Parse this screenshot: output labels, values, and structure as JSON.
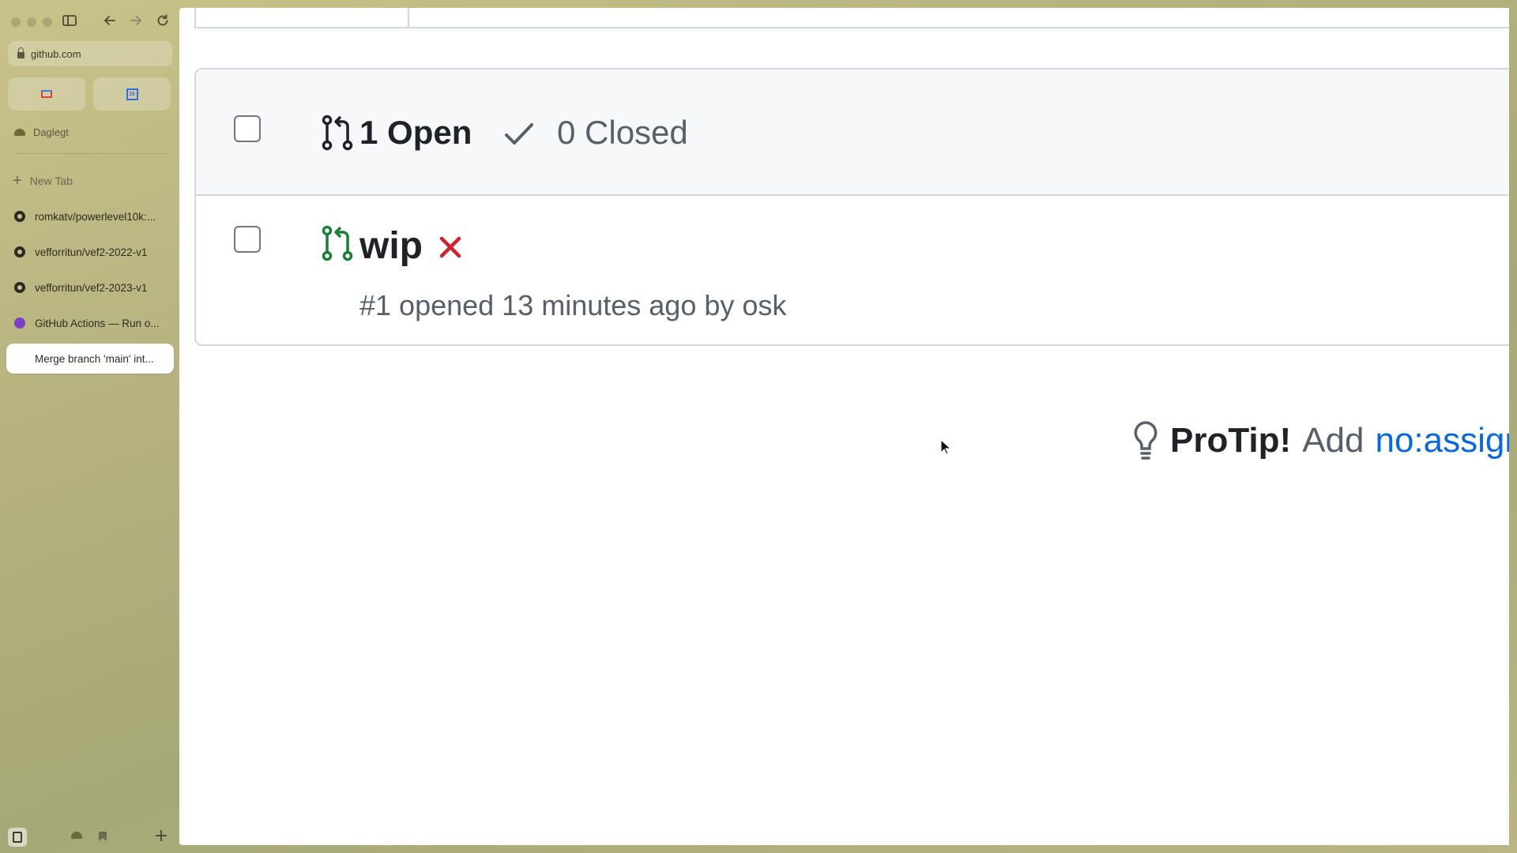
{
  "browser": {
    "url": "github.com",
    "space_name": "Daglegt",
    "new_tab_label": "New Tab",
    "tabs": [
      {
        "label": "romkatv/powerlevel10k:...",
        "icon": "github-icon"
      },
      {
        "label": "vefforritun/vef2-2022-v1",
        "icon": "github-icon"
      },
      {
        "label": "vefforritun/vef2-2023-v1",
        "icon": "github-icon"
      },
      {
        "label": "GitHub Actions — Run o...",
        "icon": "actions-icon"
      },
      {
        "label": "Merge branch 'main' int...",
        "icon": "blank-icon",
        "active": true
      }
    ],
    "pinned": [
      "gmail-icon",
      "calendar-icon"
    ],
    "calendar_day": "16"
  },
  "pulls": {
    "open_count_label": "1 Open",
    "closed_count_label": "0 Closed",
    "rows": [
      {
        "title": "wip",
        "meta": "#1 opened 13 minutes ago by osk",
        "status": "failing"
      }
    ]
  },
  "protip": {
    "strong": "ProTip!",
    "text": "Add",
    "link": "no:assign"
  },
  "colors": {
    "open_green": "#1a7f37",
    "fail_red": "#cf222e",
    "link_blue": "#0969da",
    "border": "#d0d7de"
  }
}
